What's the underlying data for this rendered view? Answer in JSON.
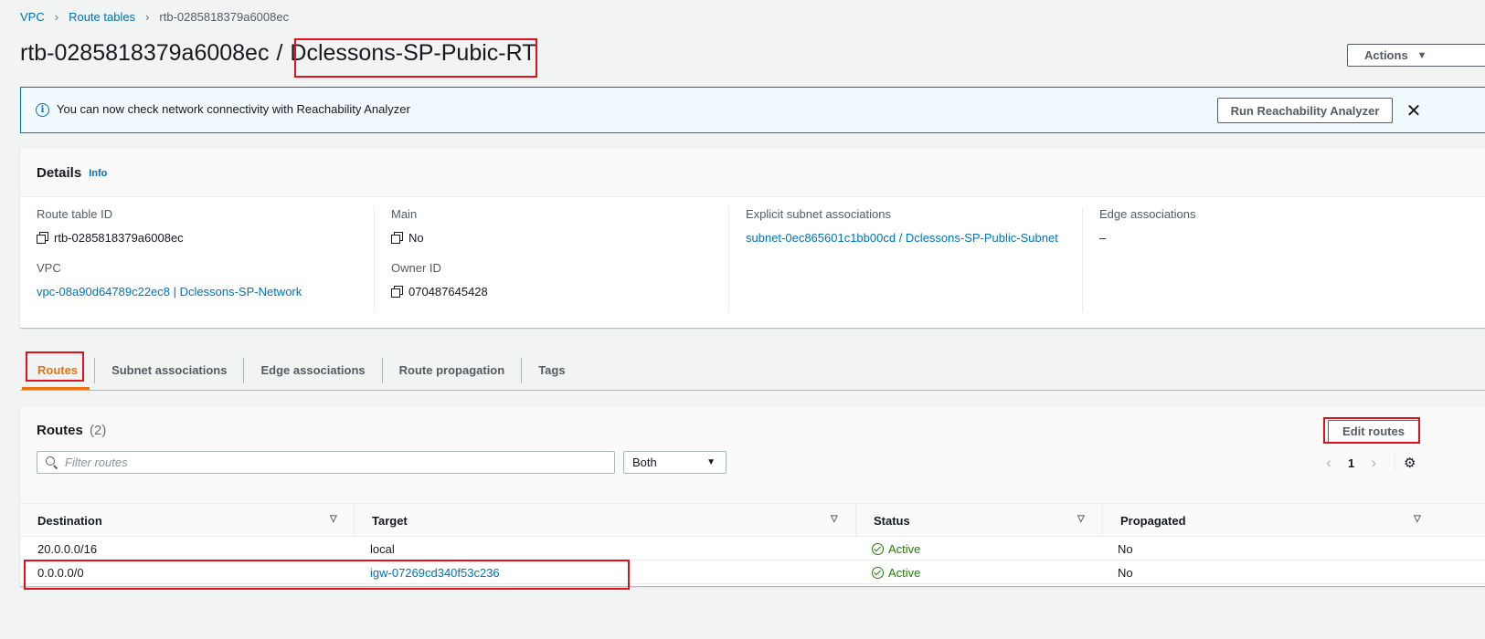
{
  "breadcrumb": {
    "items": [
      "VPC",
      "Route tables"
    ],
    "current": "rtb-0285818379a6008ec"
  },
  "header": {
    "route_table_id": "rtb-0285818379a6008ec",
    "separator": "/",
    "name": "Dclessons-SP-Pubic-RT",
    "actions_label": "Actions"
  },
  "banner": {
    "message": "You can now check network connectivity with Reachability Analyzer",
    "button_label": "Run Reachability Analyzer",
    "close_symbol": "✕"
  },
  "details": {
    "title": "Details",
    "info_label": "Info",
    "route_table_id_label": "Route table ID",
    "route_table_id_value": "rtb-0285818379a6008ec",
    "vpc_label": "VPC",
    "vpc_value": "vpc-08a90d64789c22ec8 | Dclessons-SP-Network",
    "main_label": "Main",
    "main_value": "No",
    "owner_label": "Owner ID",
    "owner_value": "070487645428",
    "explicit_label": "Explicit subnet associations",
    "explicit_value": "subnet-0ec865601c1bb00cd / Dclessons-SP-Public-Subnet",
    "edge_label": "Edge associations",
    "edge_value": "–"
  },
  "tabs": [
    "Routes",
    "Subnet associations",
    "Edge associations",
    "Route propagation",
    "Tags"
  ],
  "routes": {
    "title": "Routes",
    "count": "(2)",
    "edit_label": "Edit routes",
    "filter_placeholder": "Filter routes",
    "select_value": "Both",
    "page": "1",
    "columns": [
      "Destination",
      "Target",
      "Status",
      "Propagated"
    ],
    "rows": [
      {
        "destination": "20.0.0.0/16",
        "target": "local",
        "target_is_link": false,
        "status": "Active",
        "propagated": "No"
      },
      {
        "destination": "0.0.0.0/0",
        "target": "igw-07269cd340f53c236",
        "target_is_link": true,
        "status": "Active",
        "propagated": "No"
      }
    ]
  },
  "colors": {
    "link": "#0073bb",
    "active_tab": "#ec7211",
    "status_ok": "#1d8102",
    "annotation_red": "#e0101c"
  },
  "icons": [
    "chevron-right-icon",
    "caret-down-icon",
    "info-icon",
    "close-icon",
    "copy-icon",
    "search-icon",
    "gear-icon",
    "sort-icon",
    "check-circle-icon"
  ]
}
